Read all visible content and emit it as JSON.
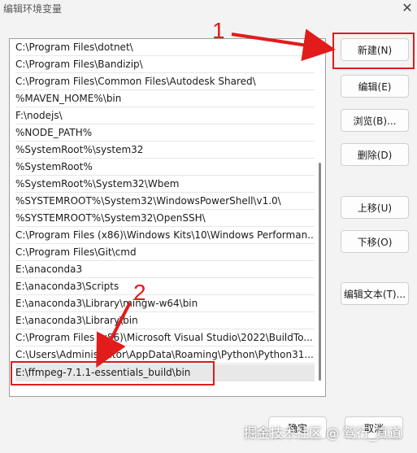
{
  "window": {
    "title": "编辑环境变量"
  },
  "list": {
    "items": [
      "C:\\Program Files\\dotnet\\",
      "C:\\Program Files\\Bandizip\\",
      "C:\\Program Files\\Common Files\\Autodesk Shared\\",
      "%MAVEN_HOME%\\bin",
      "F:\\nodejs\\",
      "%NODE_PATH%",
      "%SystemRoot%\\system32",
      "%SystemRoot%",
      "%SystemRoot%\\System32\\Wbem",
      "%SYSTEMROOT%\\System32\\WindowsPowerShell\\v1.0\\",
      "%SYSTEMROOT%\\System32\\OpenSSH\\",
      "C:\\Program Files (x86)\\Windows Kits\\10\\Windows Performan...",
      "C:\\Program Files\\Git\\cmd",
      "E:\\anaconda3",
      "E:\\anaconda3\\Scripts",
      "E:\\anaconda3\\Library\\mingw-w64\\bin",
      "E:\\anaconda3\\Library\\bin",
      "C:\\Program Files (x86)\\Microsoft Visual Studio\\2022\\BuildTo...",
      "C:\\Users\\Administrator\\AppData\\Roaming\\Python\\Python31...",
      "E:\\ffmpeg-7.1.1-essentials_build\\bin"
    ]
  },
  "buttons": {
    "new": "新建(N)",
    "edit": "编辑(E)",
    "browse": "浏览(B)...",
    "delete": "删除(D)",
    "move_up": "上移(U)",
    "move_down": "下移(O)",
    "edit_text": "编辑文本(T)...",
    "ok": "确定",
    "cancel": "取消"
  },
  "annotations": {
    "label_1": "1",
    "label_2": "2",
    "color": "#e21b1b"
  },
  "watermark": "掘金技术社区 @ 驾行_真道"
}
